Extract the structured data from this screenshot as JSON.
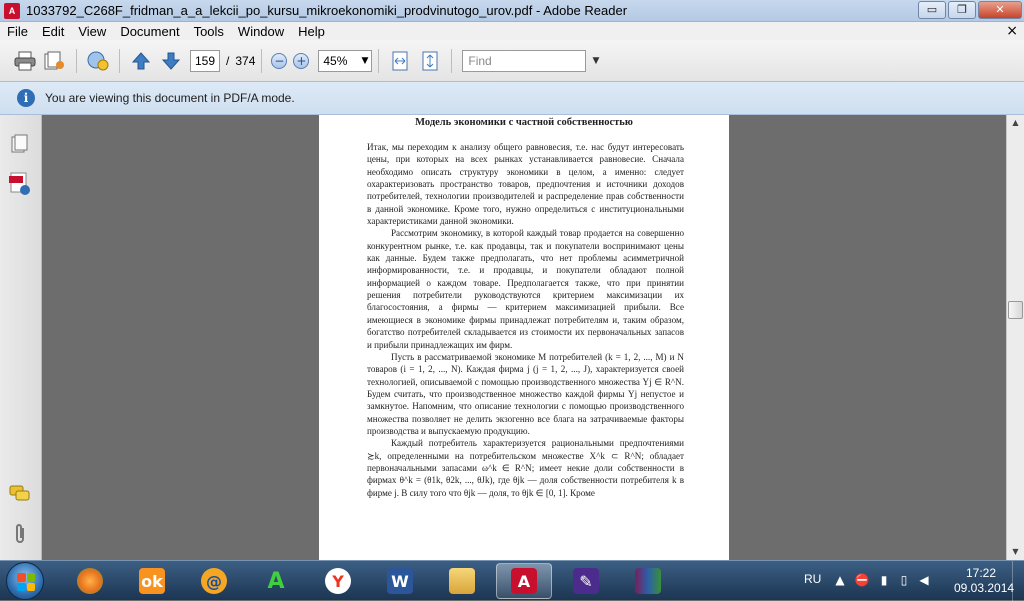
{
  "window": {
    "title": "1033792_C268F_fridman_a_a_lekcii_po_kursu_mikroekonomiki_prodvinutogo_urov.pdf - Adobe Reader",
    "controls": {
      "minimize": "▭",
      "maximize": "❐",
      "close": "✕"
    }
  },
  "menu": {
    "items": [
      "File",
      "Edit",
      "View",
      "Document",
      "Tools",
      "Window",
      "Help"
    ],
    "close_glyph": "×"
  },
  "toolbar": {
    "current_page": "159",
    "page_separator": "/",
    "total_pages": "374",
    "zoom": "45%",
    "find_placeholder": "Find"
  },
  "infobar": {
    "message": "You are viewing this document in PDF/A mode."
  },
  "document": {
    "section_title": "Модель экономики с частной собственностью",
    "paragraphs": [
      "Итак, мы переходим к анализу общего равновесия, т.е. нас будут интересовать цены, при которых на всех рынках устанавливается равновесие. Сначала необходимо описать структуру экономики в целом, а именно: следует охарактеризовать пространство товаров, предпочтения и источники доходов потребителей, технологии производителей и распределение прав собственности в данной экономике. Кроме того, нужно определиться с институциональными характеристиками данной экономики.",
      "Рассмотрим экономику, в которой каждый товар продается на совершенно конкурентном рынке, т.е. как продавцы, так и покупатели воспринимают цены как данные. Будем также предполагать, что нет проблемы асимметричной информированности, т.е. и продавцы, и покупатели обладают полной информацией о каждом товаре. Предполагается также, что при принятии решения потребители руководствуются критерием максимизации их благосостояния, а фирмы — критерием максимизацией прибыли. Все имеющиеся в экономике фирмы принадлежат потребителям и, таким образом, богатство потребителей складывается из стоимости их первоначальных запасов и прибыли принадлежащих им фирм.",
      "Пусть в рассматриваемой экономике M потребителей (k = 1, 2, ..., M) и N товаров (i = 1, 2, ..., N). Каждая фирма j (j = 1, 2, ..., J), характеризуется своей технологией, описываемой с помощью производственного множества Yj ∈ R^N. Будем считать, что производственное множество каждой фирмы Yj непустое и замкнутое. Напомним, что описание технологии с помощью производственного множества позволяет не делить экзогенно все блага на затрачиваемые факторы производства и выпускаемую продукцию.",
      "Каждый потребитель характеризуется рациональными предпочтениями ≿k, определенными на потребительском множестве X^k ⊂ R^N; обладает первоначальными запасами ω^k ∈ R^N; имеет некие доли собственности в фирмах θ^k = (θ1k, θ2k, ..., θJk), где θjk — доля собственности потребителя k в фирме j. В силу того что θjk — доля, то θjk ∈ [0, 1]. Кроме"
    ]
  },
  "taskbar": {
    "language": "RU",
    "time": "17:22",
    "date": "09.03.2014"
  },
  "colors": {
    "titlebar": "#b9cce6",
    "infobar": "#d6e4f2",
    "docarea": "#6d6d6d",
    "taskbar": "#2a4a6d",
    "accent_blue": "#2f6db5",
    "adobe_red": "#c8102e"
  }
}
